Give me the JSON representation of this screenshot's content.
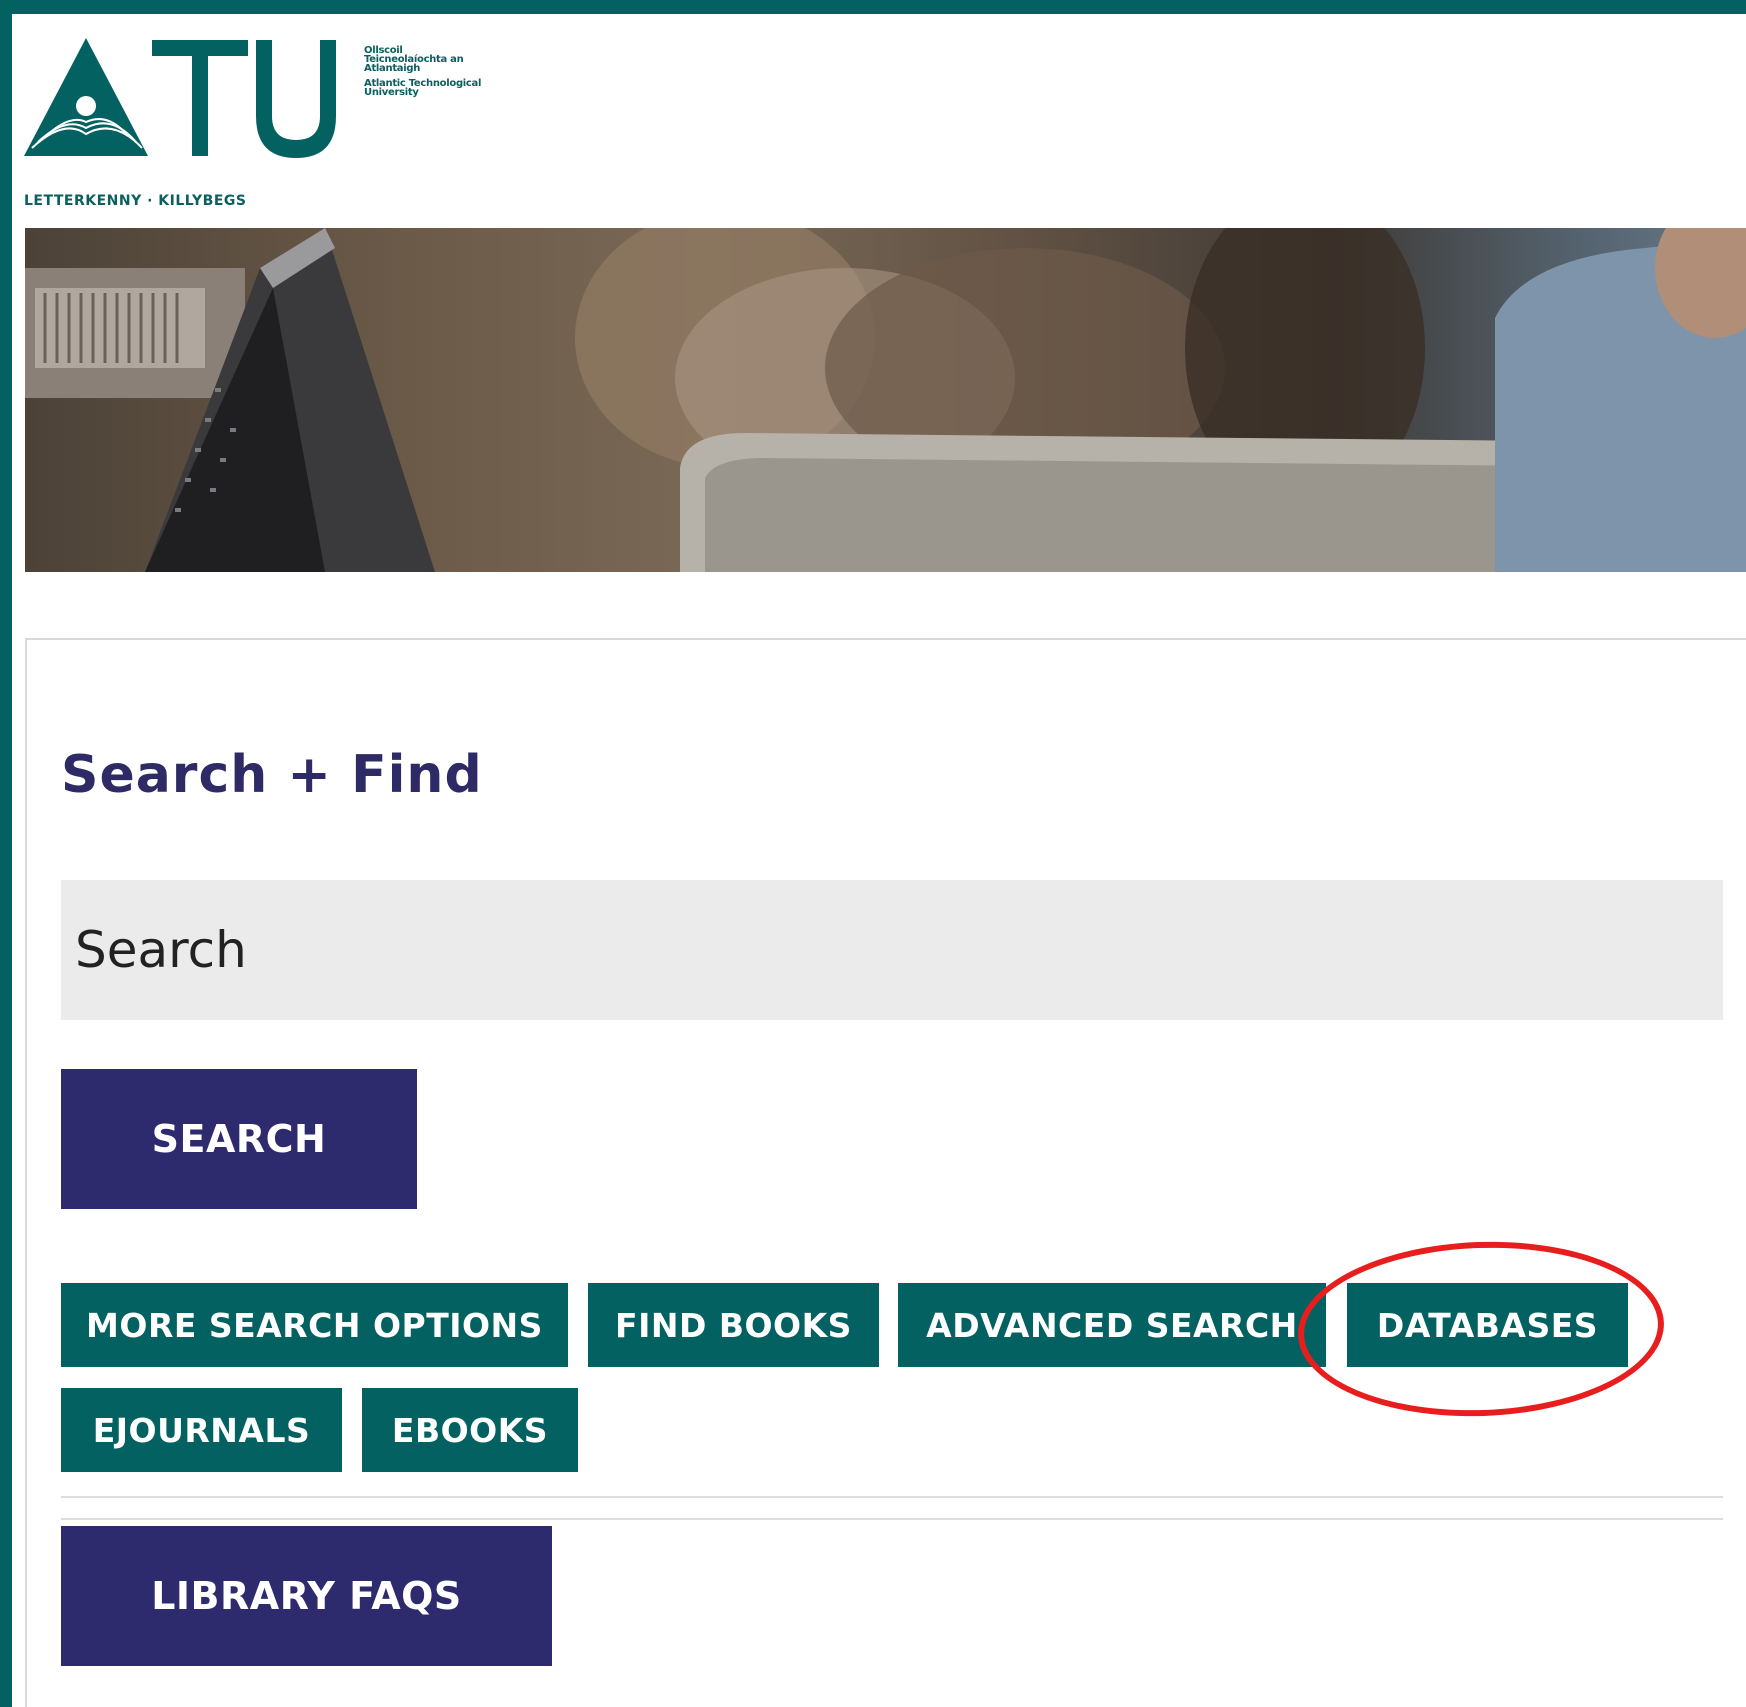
{
  "brand": {
    "logo_text": "ATU",
    "logo_small_irish": "Ollscoil Teicneolaíochta an Atlantaigh",
    "logo_small_english": "Atlantic Technological University",
    "campuses": "LETTERKENNY · KILLYBEGS",
    "colors": {
      "teal": "#046161",
      "purple": "#2e2a6e",
      "highlight": "#e81e1e"
    }
  },
  "section": {
    "title": "Search + Find",
    "search_placeholder": "Search",
    "search_button": "SEARCH",
    "links": [
      {
        "label": "MORE SEARCH OPTIONS"
      },
      {
        "label": "FIND BOOKS"
      },
      {
        "label": "ADVANCED SEARCH"
      },
      {
        "label": "DATABASES"
      },
      {
        "label": "EJOURNALS"
      },
      {
        "label": "EBOOKS"
      }
    ],
    "faqs_button": "LIBRARY FAQS",
    "highlighted_link": "DATABASES"
  }
}
